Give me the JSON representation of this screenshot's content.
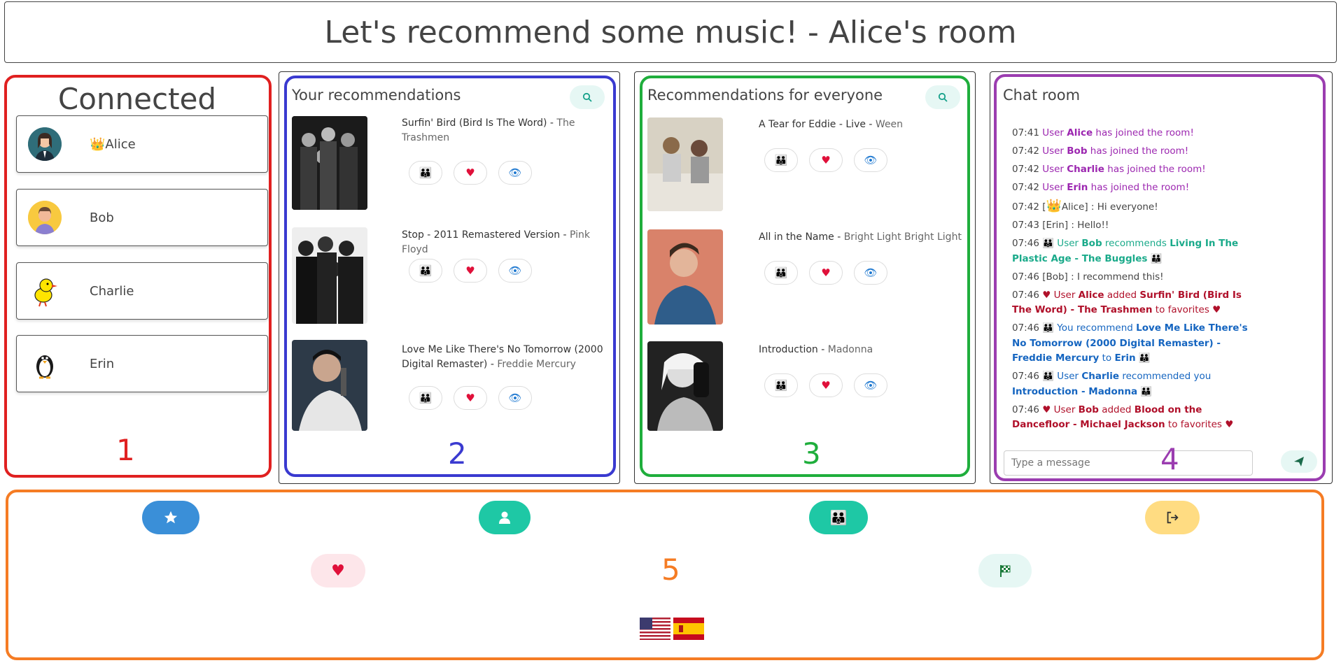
{
  "header": {
    "title": "Let's recommend some music! - Alice's room"
  },
  "connected": {
    "title": "Connected",
    "users": [
      {
        "name": "Alice",
        "crown": "👑",
        "avatar_icon": "woman-avatar-icon"
      },
      {
        "name": "Bob",
        "avatar_icon": "man-avatar-icon"
      },
      {
        "name": "Charlie",
        "avatar_icon": "chick-avatar-icon"
      },
      {
        "name": "Erin",
        "avatar_icon": "penguin-avatar-icon"
      }
    ]
  },
  "your_recs": {
    "title": "Your recommendations",
    "items": [
      {
        "song": "Surfin' Bird (Bird Is The Word)",
        "sep": " - ",
        "artist": "The Trashmen"
      },
      {
        "song": "Stop - 2011 Remastered Version",
        "sep": " - ",
        "artist": "Pink Floyd"
      },
      {
        "song": "Love Me Like There's No Tomorrow (2000 Digital Remaster)",
        "sep": " - ",
        "artist": "Freddie Mercury"
      }
    ]
  },
  "everyone_recs": {
    "title": "Recommendations for everyone",
    "items": [
      {
        "song": "A Tear for Eddie - Live",
        "sep": " - ",
        "artist": "Ween"
      },
      {
        "song": "All in the Name",
        "sep": " - ",
        "artist": "Bright Light Bright Light"
      },
      {
        "song": "Introduction",
        "sep": " - ",
        "artist": "Madonna"
      }
    ]
  },
  "chat": {
    "title": "Chat room",
    "input_placeholder": "Type a message",
    "m1": {
      "time": "07:41",
      "pre": " User ",
      "who": "Alice",
      "post": " has joined the room!"
    },
    "m2": {
      "time": "07:42",
      "pre": " User ",
      "who": "Bob",
      "post": " has joined the room!"
    },
    "m3": {
      "time": "07:42",
      "pre": " User ",
      "who": "Charlie",
      "post": " has joined the room!"
    },
    "m4": {
      "time": "07:42",
      "pre": " User ",
      "who": "Erin",
      "post": " has joined the room!"
    },
    "m5": {
      "time": "07:42",
      "open": " [",
      "crown": "👑",
      "who": "Alice",
      "text": "] : Hi everyone!"
    },
    "m6": {
      "time": "07:43",
      "text": " [Erin] : Hello!!"
    },
    "m7": {
      "time": "07:46",
      "pre": " User ",
      "who": "Bob",
      "mid": " recommends ",
      "song": "Living In The Plastic Age - The Buggles"
    },
    "m8": {
      "time": "07:46",
      "text": " [Bob] : I recommend this!"
    },
    "m9": {
      "time": "07:46",
      "pre": " User ",
      "who": "Alice",
      "mid": " added ",
      "song": "Surfin' Bird (Bird Is The Word) - The Trashmen",
      "post": " to favorites "
    },
    "m10": {
      "time": "07:46",
      "pre": " You recommend ",
      "song": "Love Me Like There's No Tomorrow (2000 Digital Remaster) - Freddie Mercury",
      "mid": " to ",
      "who": "Erin"
    },
    "m11": {
      "time": "07:46",
      "pre": " User ",
      "who": "Charlie",
      "mid": " recommended you ",
      "song": "Introduction - Madonna"
    },
    "m12": {
      "time": "07:46",
      "pre": " User ",
      "who": "Bob",
      "mid": " added ",
      "song": "Blood on the Dancefloor - Michael Jackson",
      "post": " to favorites "
    }
  },
  "regions": {
    "r1": "1",
    "r2": "2",
    "r3": "3",
    "r4": "4",
    "r5": "5"
  },
  "colors": {
    "red_region": "#e02020",
    "blue_region": "#3a3ad0",
    "green_region": "#1fae3c",
    "purple_region": "#9b3db0",
    "orange_region": "#f57c24",
    "teal": "#1ec8a5",
    "heart": "#e0103a",
    "eye": "#1e78d0",
    "star_btn": "#3a8fd8",
    "exit_btn": "#ffdc82"
  },
  "flags": [
    "us-flag-icon",
    "es-flag-icon"
  ]
}
